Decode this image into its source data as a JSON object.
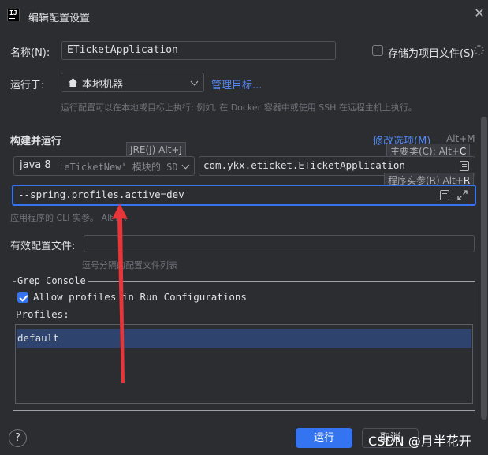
{
  "window": {
    "title": "编辑配置设置",
    "close_icon": "close-icon"
  },
  "name_row": {
    "label": "名称(N):",
    "value": "ETicketApplication",
    "store_label": "存储为项目文件(S)"
  },
  "run_on": {
    "label": "运行于:",
    "target": "本地机器",
    "manage_link": "管理目标...",
    "hint": "运行配置可以在本地或目标上执行: 例如, 在 Docker 容器中或使用 SSH 在远程主机上执行。"
  },
  "build_run": {
    "section": "构建并运行",
    "modify_options": "修改选项(M)",
    "modify_shortcut": "Alt+M",
    "jre_tip": "JRE(J) Alt+J",
    "jre_tip_label": "JRE(J) Alt+",
    "jre_tip_key": "J",
    "main_class_tip_label": "主要类(C): Alt+",
    "main_class_tip_key": "C",
    "prog_args_tip_label": "程序实参(R) Alt+",
    "prog_args_tip_key": "R",
    "jdk_value": "java 8",
    "jdk_detail": "'eTicketNew' 模块的 SDK",
    "main_class": "com.ykx.eticket.ETicketApplication",
    "program_args": "--spring.profiles.active=dev",
    "args_hint": "应用程序的 CLI 实参。 Alt+R"
  },
  "profiles_file": {
    "label": "有效配置文件:",
    "value": "",
    "hint": "逗号分隔的配置文件列表"
  },
  "grep_console": {
    "title": "Grep Console",
    "allow_label": "Allow profiles in Run Configurations",
    "allow_checked": true,
    "profiles_label": "Profiles:",
    "items": [
      "default"
    ]
  },
  "footer": {
    "help": "?",
    "run_button": "运行",
    "cancel_button": "取消",
    "watermark": "CSDN @月半花开"
  },
  "colors": {
    "accent": "#3574f0",
    "link": "#548af7",
    "arrow": "#e8353a",
    "background": "#2b2d30"
  }
}
